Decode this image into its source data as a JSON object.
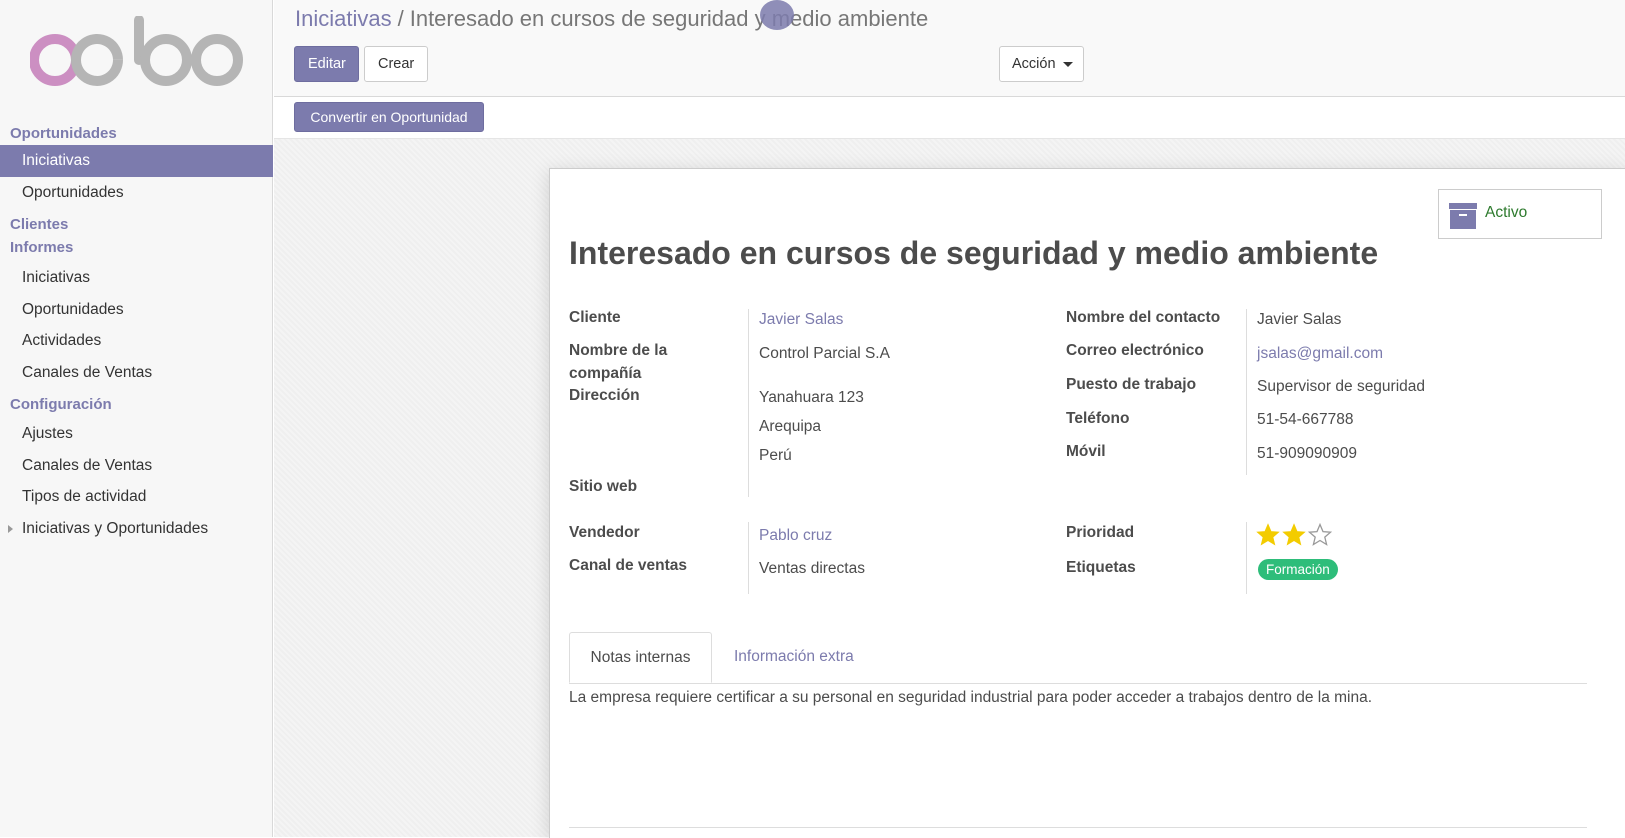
{
  "sidebar": {
    "logo_text": "odoo",
    "sections": {
      "oportunidades": "Oportunidades",
      "clientes": "Clientes",
      "informes": "Informes",
      "configuracion": "Configuración"
    },
    "items": {
      "iniciativas": "Iniciativas",
      "oportunidades": "Oportunidades",
      "inf_iniciativas": "Iniciativas",
      "inf_oportunidades": "Oportunidades",
      "inf_actividades": "Actividades",
      "inf_canales": "Canales de Ventas",
      "cfg_ajustes": "Ajustes",
      "cfg_canales": "Canales de Ventas",
      "cfg_tipos": "Tipos de actividad",
      "cfg_iniciativas_op": "Iniciativas y Oportunidades"
    }
  },
  "breadcrumb": {
    "parent": "Iniciativas",
    "separator": "/",
    "current": "Interesado en cursos de seguridad y medio ambiente"
  },
  "toolbar": {
    "edit": "Editar",
    "create": "Crear",
    "action": "Acción"
  },
  "statusbar": {
    "convert": "Convertir en Oportunidad"
  },
  "form": {
    "active_label": "Activo",
    "title": "Interesado en cursos de seguridad y medio ambiente",
    "labels": {
      "cliente": "Cliente",
      "compania": "Nombre de la compañía",
      "direccion": "Dirección",
      "sitio": "Sitio web",
      "vendedor": "Vendedor",
      "canal": "Canal de ventas",
      "contacto": "Nombre del contacto",
      "correo": "Correo electrónico",
      "puesto": "Puesto de trabajo",
      "telefono": "Teléfono",
      "movil": "Móvil",
      "prioridad": "Prioridad",
      "etiquetas": "Etiquetas"
    },
    "values": {
      "cliente": "Javier Salas",
      "compania": "Control Parcial S.A",
      "direccion_1": "Yanahuara 123",
      "direccion_2": "Arequipa",
      "direccion_3": "Perú",
      "vendedor": "Pablo cruz",
      "canal": "Ventas directas",
      "contacto": "Javier Salas",
      "correo": "jsalas@gmail.com",
      "puesto": "Supervisor de seguridad",
      "telefono": "51-54-667788",
      "movil": "51-909090909",
      "prioridad_stars": 2,
      "prioridad_max": 3,
      "etiqueta": "Formación"
    },
    "tabs": {
      "notas": "Notas internas",
      "extra": "Información extra"
    },
    "note": "La empresa requiere certificar a su personal en seguridad industrial para poder acceder a trabajos dentro de la mina."
  },
  "colors": {
    "brand": "#7c7bad",
    "star": "#f3cc00",
    "tag": "#2ebd7a",
    "active": "#2d7a2d"
  },
  "icons": {
    "archive": "archive-icon",
    "caret": "caret-down-icon",
    "star": "star-icon"
  }
}
